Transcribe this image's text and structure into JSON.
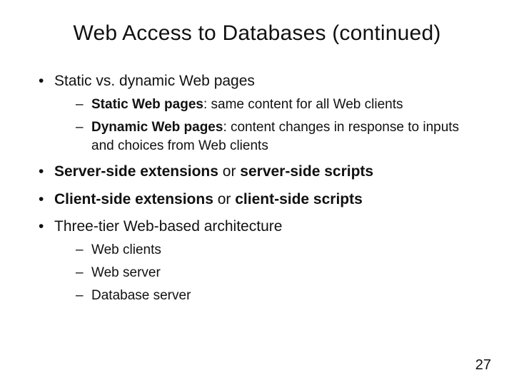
{
  "title": "Web Access to Databases (continued)",
  "page_number": "27",
  "bullets": {
    "b1": {
      "text": "Static vs. dynamic Web pages",
      "sub": {
        "s1_bold": "Static Web pages",
        "s1_rest": ": same content for all Web clients",
        "s2_bold": "Dynamic Web pages",
        "s2_rest": ": content changes in response to inputs and choices from Web clients"
      }
    },
    "b2": {
      "strong1": "Server-side extensions",
      "mid": " or ",
      "strong2": "server-side scripts"
    },
    "b3": {
      "strong1": "Client-side extensions",
      "mid": " or ",
      "strong2": "client-side scripts"
    },
    "b4": {
      "text": "Three-tier Web-based architecture",
      "sub": {
        "s1": "Web clients",
        "s2": "Web server",
        "s3": "Database server"
      }
    }
  }
}
